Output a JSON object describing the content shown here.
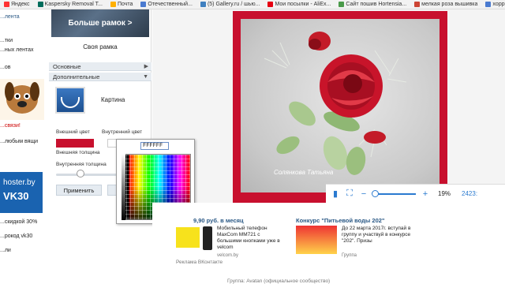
{
  "bookmarks": [
    {
      "label": "Яндекс",
      "color": "#ff3333"
    },
    {
      "label": "Kaspersky Removal T...",
      "color": "#006d5c"
    },
    {
      "label": "Почта",
      "color": "#ffb000"
    },
    {
      "label": "Отечественный...",
      "color": "#4a7ad0"
    },
    {
      "label": "(5) Gallery.ru / шью...",
      "color": "#4080c0"
    },
    {
      "label": "Мои посылки - AliEx...",
      "color": "#e60012"
    },
    {
      "label": "Сайт пошив Hortensia...",
      "color": "#4a9a4a"
    },
    {
      "label": "мелкая роза вышивка",
      "color": "#c43"
    },
    {
      "label": "xoppecraftvideos",
      "color": "#4a7ad0"
    }
  ],
  "left_col": {
    "items": [
      "...лента",
      "...тки",
      "...ных лентах",
      "...ов",
      "...связи!",
      "...любым вящи",
      "...скидкой 30%",
      "...рокод vk30",
      "...ли"
    ],
    "hoster": {
      "line1": "hoster.by",
      "line2": "VK30"
    }
  },
  "panel": {
    "more_button": "Больше рамок >",
    "own_frame": "Своя рамка",
    "section_basic": "Основные",
    "section_extra": "Дополнительные",
    "picture_label": "Картина",
    "outer_color_label": "Внешний цвет",
    "inner_color_label": "Внутренний цвет",
    "outer_thickness_label": "Внешняя толщина",
    "inner_thickness_label": "Внутренняя толщина",
    "apply_button": "Применить",
    "outer_color": "#c8102e",
    "inner_color": "#ffffff"
  },
  "picker": {
    "hex_value": "FFFFFF"
  },
  "preview": {
    "watermark": "Солянкова Татьяна",
    "frame_color": "#c8102e"
  },
  "zoombar": {
    "percent": "19%",
    "end_text": "2423:"
  },
  "ads": {
    "price_title": "9,90 руб. в месяц",
    "phone_text": "Мобильный телефон MaxCom MM721 с большими кнопками уже в velcom",
    "phone_sub": "velcom.by",
    "contest_title": "Конкурс \"Питьевой воды 202\"",
    "contest_text": "До 22 марта 2017г. вступай в группу и участвуй в конкурсе \"202\". Призы",
    "contest_sub": "Группа",
    "footer": "Реклама ВКонтакте",
    "bottom": "Группа: Avatan (официальное сообщество)"
  }
}
